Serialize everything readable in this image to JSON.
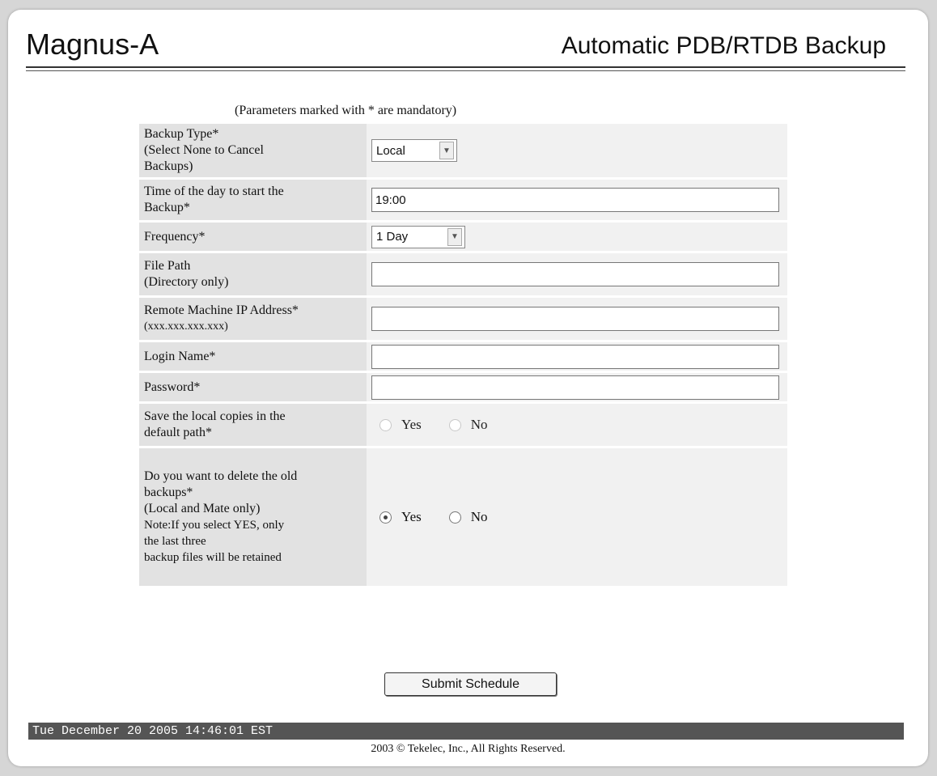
{
  "header": {
    "system_name": "Magnus-A",
    "page_title": "Automatic PDB/RTDB Backup"
  },
  "form": {
    "mandatory_note": "(Parameters marked with * are mandatory)",
    "backup_type": {
      "label_lines": [
        "Backup Type*",
        "(Select None to Cancel",
        "Backups)"
      ],
      "selected": "Local"
    },
    "start_time": {
      "label_lines": [
        "Time of the day to start the",
        "Backup*"
      ],
      "value": "19:00"
    },
    "frequency": {
      "label": "Frequency*",
      "selected": "1 Day"
    },
    "file_path": {
      "label_lines": [
        "File Path",
        "(Directory only)"
      ],
      "value": ""
    },
    "remote_ip": {
      "label_lines": [
        "Remote Machine IP Address*",
        "(xxx.xxx.xxx.xxx)"
      ],
      "value": ""
    },
    "login_name": {
      "label": "Login Name*",
      "value": ""
    },
    "password": {
      "label": "Password*",
      "value": ""
    },
    "save_local": {
      "label_lines": [
        "Save the local copies in the",
        "default path*"
      ],
      "options": [
        "Yes",
        "No"
      ],
      "selected": null,
      "disabled": true
    },
    "delete_old": {
      "label_lines": [
        "Do you want to delete the old",
        "backups*",
        "(Local and Mate only)",
        "Note:If you select YES, only",
        "the last three",
        "backup files will be retained"
      ],
      "options": [
        "Yes",
        "No"
      ],
      "selected": "Yes"
    },
    "submit_label": "Submit Schedule"
  },
  "footer": {
    "timestamp": "Tue December 20 2005 14:46:01 EST",
    "copyright": "2003 © Tekelec, Inc., All Rights Reserved."
  }
}
